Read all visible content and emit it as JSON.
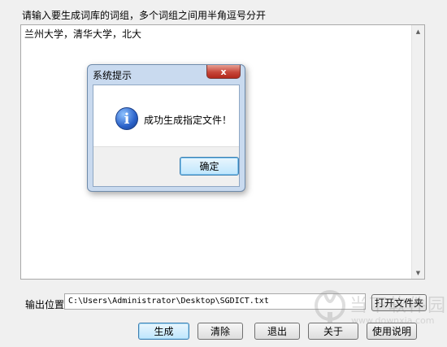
{
  "instruction": "请输入要生成词库的词组，多个词组之间用半角逗号分开",
  "input_text": "兰州大学，清华大学，北大",
  "output": {
    "label": "输出位置",
    "path": "C:\\Users\\Administrator\\Desktop\\SGDICT.txt",
    "open_folder_button": "打开文件夹"
  },
  "buttons": {
    "generate": "生成",
    "clear": "清除",
    "exit": "退出",
    "about": "关于",
    "help": "使用说明"
  },
  "dialog": {
    "title": "系统提示",
    "close_glyph": "x",
    "icon": "info-icon",
    "message": "成功生成指定文件！",
    "ok_button": "确定"
  },
  "watermark": {
    "text_main": "当下软件园",
    "text_sub": "www.downxia.com"
  }
}
